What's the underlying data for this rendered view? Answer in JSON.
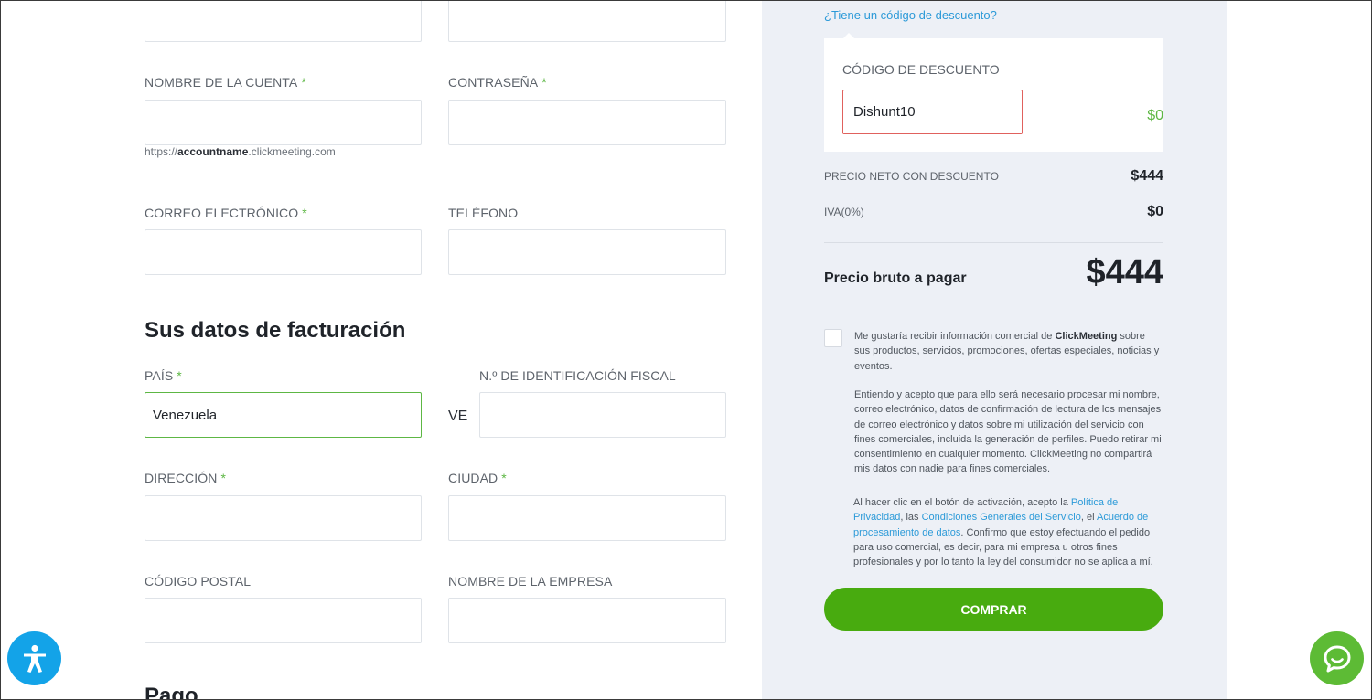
{
  "account": {
    "fields": {
      "account_name": {
        "label": "NOMBRE DE LA CUENTA",
        "value": "",
        "placeholder": ""
      },
      "password": {
        "label": "CONTRASEÑA",
        "value": "",
        "placeholder": ""
      },
      "email": {
        "label": "CORREO ELECTRÓNICO",
        "value": "",
        "placeholder": ""
      },
      "phone": {
        "label": "TELÉFONO",
        "value": "",
        "placeholder": ""
      }
    },
    "url_hint": {
      "prefix": "https://",
      "bold": "accountname",
      "suffix": ".clickmeeting.com"
    }
  },
  "billing": {
    "title": "Sus datos de facturación",
    "country": {
      "label": "PAÍS",
      "value": "Venezuela"
    },
    "tax_prefix": "VE",
    "tax_id": {
      "label": "N.º DE IDENTIFICACIÓN FISCAL",
      "value": ""
    },
    "address": {
      "label": "DIRECCIÓN",
      "value": ""
    },
    "city": {
      "label": "CIUDAD",
      "value": ""
    },
    "postal": {
      "label": "CÓDIGO POSTAL",
      "value": ""
    },
    "company": {
      "label": "NOMBRE DE LA EMPRESA",
      "value": ""
    },
    "required_mark": "*"
  },
  "payment_title": "Pago",
  "summary": {
    "discount_link": "¿Tiene un código de descuento?",
    "discount_label": "CÓDIGO DE DESCUENTO",
    "discount_code": "Dishunt10",
    "discount_amount": "$0",
    "net_label": "PRECIO NETO CON DESCUENTO",
    "net_value": "$444",
    "vat_label": "IVA(0%)",
    "vat_value": "$0",
    "total_label": "Precio bruto a pagar",
    "total_value": "$444",
    "marketing_pre": "Me gustaría recibir información comercial de ",
    "marketing_brand": "ClickMeeting",
    "marketing_post": " sobre sus productos, servicios, promociones, ofertas especiales, noticias y eventos.",
    "consent_text": "Entiendo y acepto que para ello será necesario procesar mi nombre, correo electrónico, datos de confirmación de lectura de los mensajes de correo electrónico y datos sobre mi utilización del servicio con fines comerciales, incluida la generación de perfiles. Puedo retirar mi consentimiento en cualquier momento. ClickMeeting no compartirá mis datos con nadie para fines comerciales.",
    "terms_1": "Al hacer clic en el botón de activación, acepto la ",
    "privacy_link": "Política de Privacidad",
    "terms_2": ", las ",
    "conditions_link": "Condiciones Generales del Servicio",
    "terms_3": ", el ",
    "processing_link": "Acuerdo de procesamiento de datos",
    "terms_4": ". Confirmo que estoy efectuando el pedido para uso comercial, es decir, para mi empresa u otros fines profesionales y por lo tanto la ley del consumidor no se aplica a mí.",
    "buy_label": "COMPRAR"
  },
  "icons": {
    "accessibility": "accessibility-icon",
    "chat": "chat-icon"
  },
  "colors": {
    "accent_green": "#5db744",
    "button_green": "#48ab0f",
    "link_blue": "#2c9ad8",
    "error_red": "#e0615d",
    "panel_bg": "#edf0f6"
  }
}
